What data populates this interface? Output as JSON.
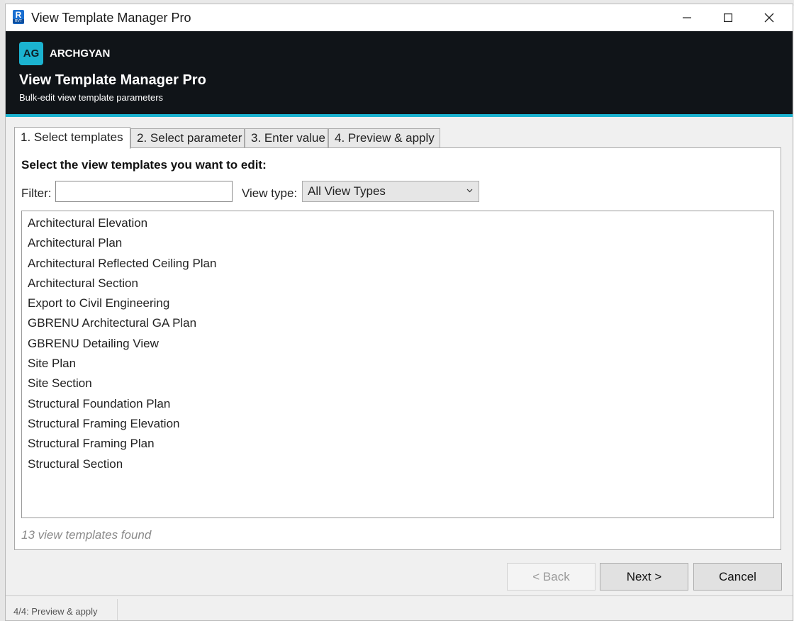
{
  "window": {
    "title": "View Template Manager Pro",
    "app_icon_letter": "R",
    "app_icon_sub": "RVT"
  },
  "header": {
    "logo_text": "AG",
    "brand": "ARCHGYAN",
    "title": "View Template Manager Pro",
    "subtitle": "Bulk-edit view template parameters",
    "accent_color": "#1bb3d0"
  },
  "tabs": [
    {
      "label": "1. Select templates",
      "active": true
    },
    {
      "label": "2. Select parameter",
      "active": false
    },
    {
      "label": "3. Enter value",
      "active": false
    },
    {
      "label": "4. Preview & apply",
      "active": false
    }
  ],
  "panel": {
    "heading": "Select the view templates you want to edit:",
    "filter_label": "Filter:",
    "filter_value": "",
    "view_type_label": "View type:",
    "view_type_selected": "All View Types",
    "templates": [
      "Architectural Elevation",
      "Architectural Plan",
      "Architectural Reflected Ceiling Plan",
      "Architectural Section",
      "Export to Civil Engineering",
      "GBRENU Architectural GA Plan",
      "GBRENU Detailing View",
      "Site Plan",
      "Site Section",
      "Structural Foundation Plan",
      "Structural Framing Elevation",
      "Structural Framing Plan",
      "Structural Section"
    ],
    "count_text": "13 view templates found"
  },
  "buttons": {
    "back": "< Back",
    "next": "Next >",
    "cancel": "Cancel"
  },
  "status": {
    "text": "4/4: Preview & apply"
  }
}
